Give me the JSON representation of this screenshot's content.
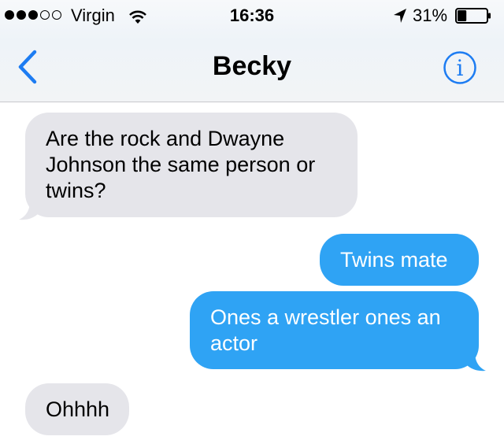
{
  "status_bar": {
    "carrier": "Virgin",
    "time": "16:36",
    "battery_percent": "31%",
    "battery_level": 0.31,
    "signal_bars_filled": 3,
    "signal_bars_total": 5
  },
  "nav": {
    "title": "Becky",
    "back_icon": "chevron-left-icon",
    "info_icon": "info-icon"
  },
  "colors": {
    "accent": "#2fa3f4",
    "received_bubble": "#e5e5ea",
    "sent_bubble": "#2fa3f4",
    "ios_blue": "#1d7cf2"
  },
  "messages": [
    {
      "direction": "received",
      "text": "Are the rock and Dwayne Johnson the same person or twins?"
    },
    {
      "direction": "sent",
      "text": "Twins mate"
    },
    {
      "direction": "sent",
      "text": "Ones a wrestler ones an actor"
    },
    {
      "direction": "received",
      "text": "Ohhhh"
    }
  ]
}
